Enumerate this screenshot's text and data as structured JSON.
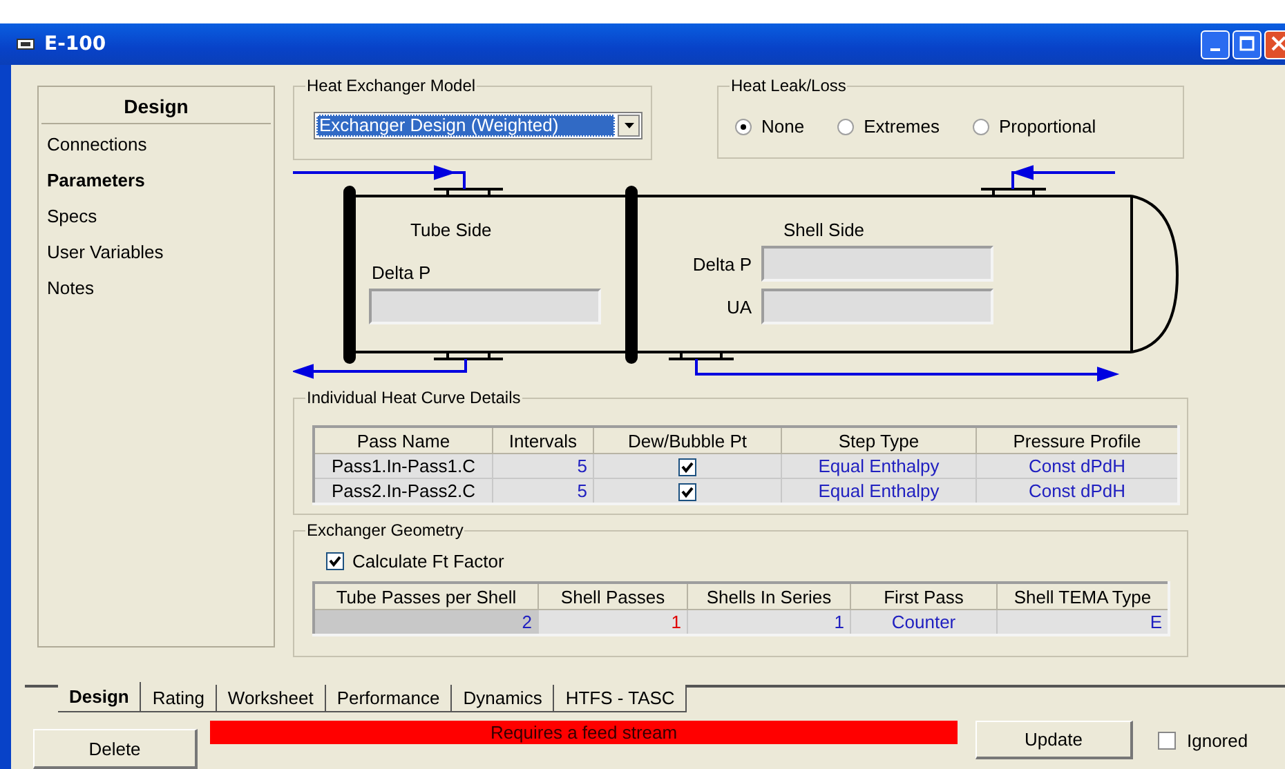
{
  "window": {
    "title": "E-100"
  },
  "sidebar": {
    "header": "Design",
    "items": [
      {
        "label": "Connections",
        "selected": false
      },
      {
        "label": "Parameters",
        "selected": true
      },
      {
        "label": "Specs",
        "selected": false
      },
      {
        "label": "User Variables",
        "selected": false
      },
      {
        "label": "Notes",
        "selected": false
      }
    ]
  },
  "model": {
    "label": "Heat Exchanger Model",
    "value": "Exchanger Design (Weighted)"
  },
  "heat_leak": {
    "label": "Heat Leak/Loss",
    "options": [
      {
        "label": "None",
        "selected": true
      },
      {
        "label": "Extremes",
        "selected": false
      },
      {
        "label": "Proportional",
        "selected": false
      }
    ]
  },
  "diagram": {
    "tube_side": {
      "title": "Tube Side",
      "fields": [
        {
          "label": "Delta P"
        }
      ]
    },
    "shell_side": {
      "title": "Shell Side",
      "fields": [
        {
          "label": "Delta P"
        },
        {
          "label": "UA"
        }
      ]
    }
  },
  "heat_curve": {
    "title": "Individual Heat Curve Details",
    "columns": [
      "Pass Name",
      "Intervals",
      "Dew/Bubble Pt",
      "Step Type",
      "Pressure Profile"
    ],
    "rows": [
      {
        "pass_name": "Pass1.In-Pass1.C",
        "intervals": "5",
        "dew_bubble_checked": true,
        "step_type": "Equal Enthalpy",
        "pressure_profile": "Const dPdH"
      },
      {
        "pass_name": "Pass2.In-Pass2.C",
        "intervals": "5",
        "dew_bubble_checked": true,
        "step_type": "Equal Enthalpy",
        "pressure_profile": "Const dPdH"
      }
    ]
  },
  "geometry": {
    "title": "Exchanger Geometry",
    "calculate_ft": {
      "label": "Calculate Ft Factor",
      "checked": true
    },
    "columns": [
      "Tube Passes per Shell",
      "Shell Passes",
      "Shells In Series",
      "First Pass",
      "Shell TEMA Type"
    ],
    "rows": [
      {
        "cells": [
          {
            "text": "2",
            "color": "#2020c0"
          },
          {
            "text": "1",
            "color": "#e00000"
          },
          {
            "text": "1",
            "color": "#2020c0"
          },
          {
            "text": "Counter",
            "color": "#2020c0"
          },
          {
            "text": "E",
            "color": "#2020c0"
          }
        ]
      }
    ]
  },
  "tabs": [
    {
      "label": "Design",
      "selected": true
    },
    {
      "label": "Rating",
      "selected": false
    },
    {
      "label": "Worksheet",
      "selected": false
    },
    {
      "label": "Performance",
      "selected": false
    },
    {
      "label": "Dynamics",
      "selected": false
    },
    {
      "label": "HTFS - TASC",
      "selected": false
    }
  ],
  "delete_button": "Delete",
  "status": {
    "text": "Requires a feed stream"
  },
  "update_button": "Update",
  "ignored": {
    "label": "Ignored",
    "checked": false
  }
}
